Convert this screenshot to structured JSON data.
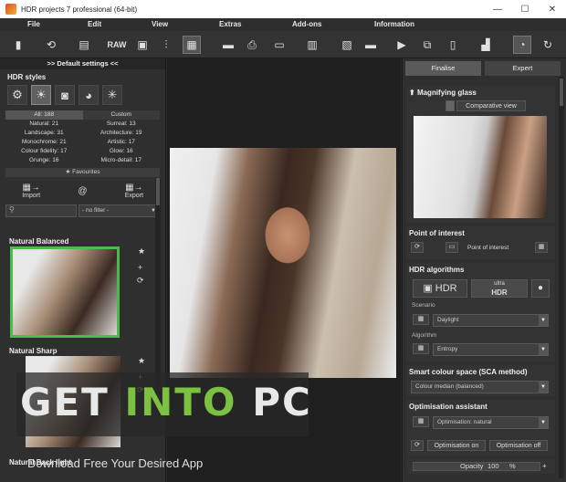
{
  "window": {
    "title": "HDR projects 7 professional (64-bit)",
    "controls": [
      "—",
      "☐",
      "✕"
    ]
  },
  "menu": [
    "File",
    "Edit",
    "View",
    "Extras",
    "Add-ons",
    "Information"
  ],
  "toolbar": {
    "raw_label": "RAW"
  },
  "left": {
    "header": ">> Default settings <<",
    "styles_title": "HDR styles",
    "categories": [
      [
        "All: 188",
        "Custom"
      ],
      [
        "Natural: 21",
        "Surreal: 13"
      ],
      [
        "Landscape: 31",
        "Architecture: 19"
      ],
      [
        "Monochrome: 21",
        "Artistic: 17"
      ],
      [
        "Colour fidelity: 17",
        "Glow: 16"
      ],
      [
        "Grunge: 16",
        "Micro-detail: 17"
      ]
    ],
    "favourites": "★ Favourites",
    "import": "Import",
    "export": "Export",
    "filter_value": "- no filter -",
    "presets": [
      "Natural Balanced",
      "Natural Sharp",
      "Natural Back light"
    ]
  },
  "right": {
    "tabs": [
      "Finalise",
      "Expert"
    ],
    "magnifier": {
      "title": "Magnifying glass",
      "comparative": "Comparative view"
    },
    "poi": {
      "title": "Point of interest",
      "button": "Point of interest"
    },
    "algorithms": {
      "title": "HDR algorithms",
      "hdr": "HDR",
      "ultra_top": "ultra",
      "ultra_bottom": "HDR",
      "scenario_label": "Scenario",
      "scenario_value": "Daylight",
      "algorithm_label": "Algorithm",
      "algorithm_value": "Entropy"
    },
    "sca": {
      "title": "Smart colour space (SCA method)",
      "value": "Colour median (balanced)"
    },
    "optimisation": {
      "title": "Optimisation assistant",
      "value": "Optimisation: natural",
      "on": "Optimisation on",
      "off": "Optimisation off"
    },
    "opacity": {
      "label": "Opacity",
      "value": "100",
      "unit": "%"
    }
  },
  "watermark": {
    "get": "GET ",
    "into": "INTO",
    "pc": " PC",
    "tagline": "Download Free Your Desired App"
  }
}
